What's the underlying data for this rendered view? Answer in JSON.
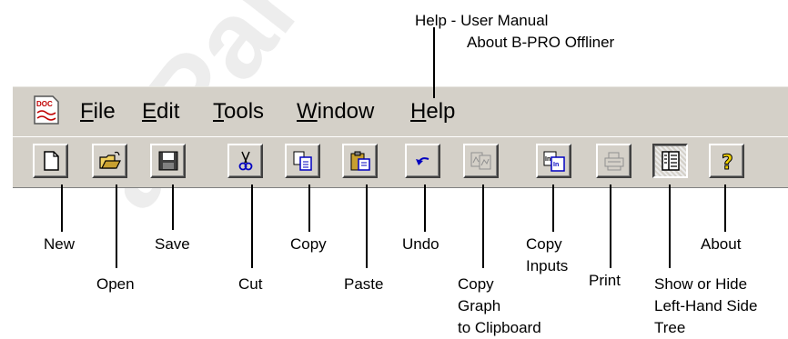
{
  "watermark": "alPartM",
  "help_note": {
    "line1": "Help - User Manual",
    "line2": "About B-PRO Offliner"
  },
  "menubar": {
    "app_icon_text": "DOC",
    "items": [
      {
        "label_first": "F",
        "label_rest": "ile"
      },
      {
        "label_first": "E",
        "label_rest": "dit"
      },
      {
        "label_first": "T",
        "label_rest": "ools"
      },
      {
        "label_first": "W",
        "label_rest": "indow"
      },
      {
        "label_first": "H",
        "label_rest": "elp"
      }
    ]
  },
  "toolbar": {
    "buttons": [
      {
        "icon": "new-document-icon"
      },
      {
        "icon": "open-folder-icon"
      },
      {
        "icon": "save-floppy-icon"
      },
      {
        "icon": "cut-scissors-icon"
      },
      {
        "icon": "copy-icon"
      },
      {
        "icon": "paste-icon"
      },
      {
        "icon": "undo-icon"
      },
      {
        "icon": "copy-graph-icon",
        "disabled": true
      },
      {
        "icon": "copy-inputs-icon"
      },
      {
        "icon": "print-icon",
        "disabled": true
      },
      {
        "icon": "tree-panel-icon",
        "pressed": true
      },
      {
        "icon": "about-question-icon"
      }
    ]
  },
  "callouts": {
    "new": "New",
    "open": "Open",
    "save": "Save",
    "cut": "Cut",
    "copy": "Copy",
    "paste": "Paste",
    "undo": "Undo",
    "copy_graph": [
      "Copy",
      "Graph",
      "to Clipboard"
    ],
    "copy_inputs": [
      "Copy",
      "Inputs"
    ],
    "print": "Print",
    "show_hide": [
      "Show or Hide",
      "Left-Hand Side",
      "Tree"
    ],
    "about": "About"
  }
}
